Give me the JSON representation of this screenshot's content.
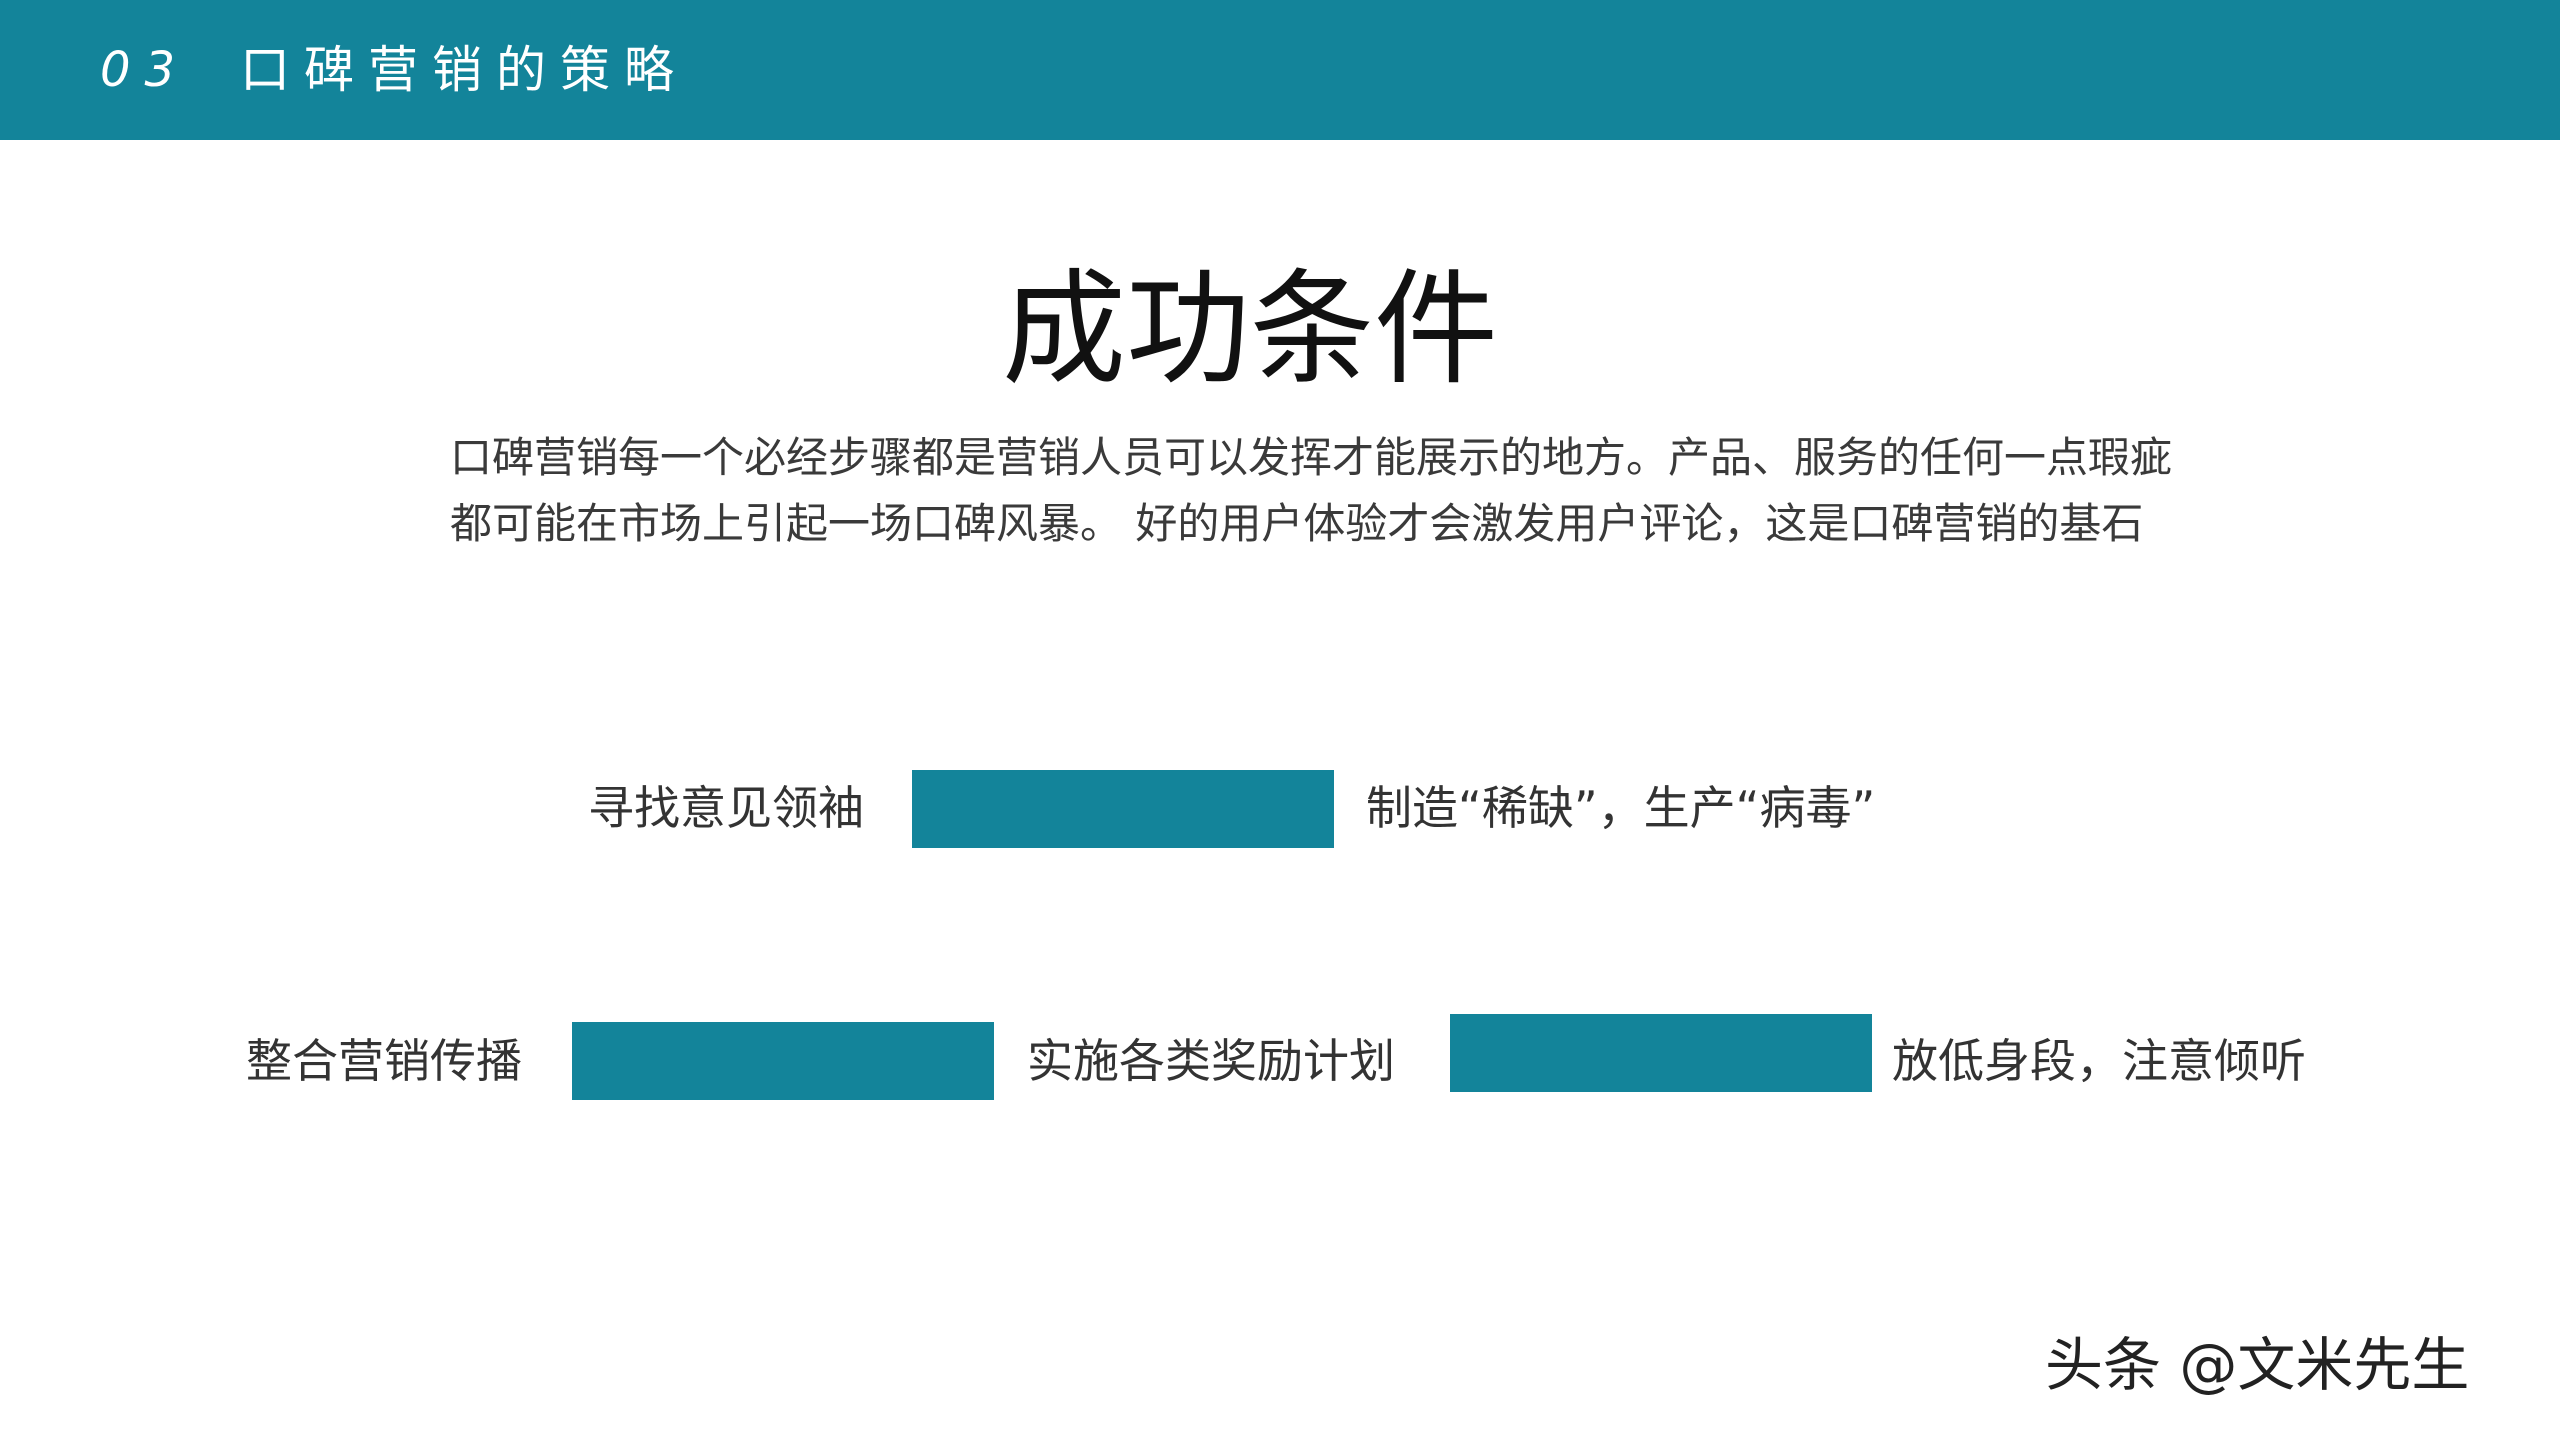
{
  "header": {
    "section_number": "03",
    "section_title": "口碑营销的策略"
  },
  "main": {
    "title": "成功条件",
    "description_lines": [
      "口碑营销每一个必经步骤都是营销人员可以发挥才能展示的地方。产品、服务的任何一点瑕疵",
      "都可能在市场上引起一场口碑风暴。 好的用户体验才会激发用户评论，这是口碑营销的基石"
    ]
  },
  "strategies": {
    "row1": [
      "寻找意见领袖",
      "制造“稀缺”，生产“病毒”"
    ],
    "row2": [
      "整合营销传播",
      "实施各类奖励计划",
      "放低身段，注意倾听"
    ]
  },
  "watermark": "头条 @文米先生",
  "colors": {
    "accent": "#13849a",
    "text": "#333333"
  }
}
